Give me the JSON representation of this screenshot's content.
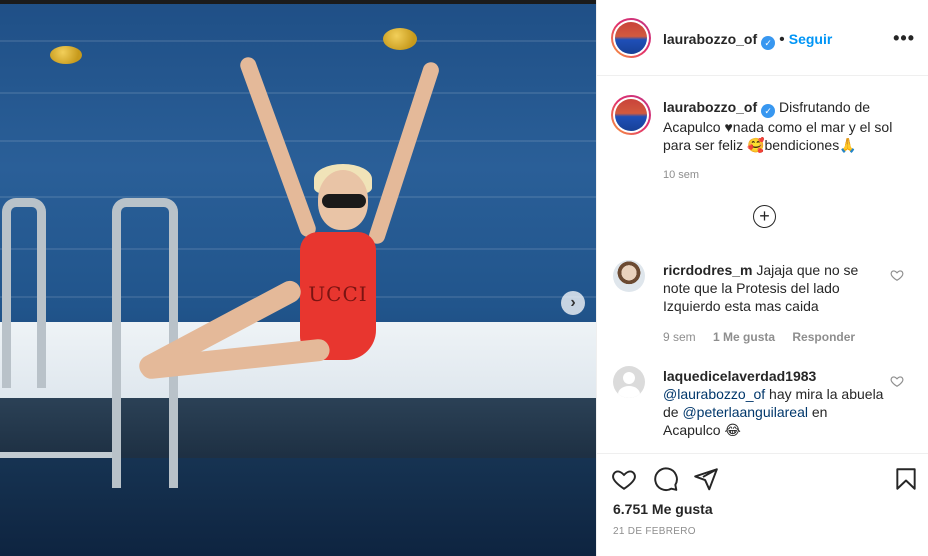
{
  "post": {
    "username": "laurabozzo_of",
    "follow_label": "Seguir",
    "separator": "•",
    "more_label": "•••",
    "caption_text": "Disfrutando de Acapulco ♥nada como el mar y el sol para ser feliz",
    "caption_tail": "bendiciones",
    "caption_emoji_1": "🥰",
    "caption_emoji_2": "🙏",
    "time_ago": "10 sem",
    "swimsuit_text": "UCCI"
  },
  "comments": [
    {
      "username": "ricrdodres_m",
      "text": "Jajaja que no se note que la Protesis del lado Izquierdo esta mas caida",
      "time": "9 sem",
      "likes": "1 Me gusta",
      "reply": "Responder"
    },
    {
      "username": "laquedicelaverdad1983",
      "mention1": "@laurabozzo_of",
      "text1": " hay mira la abuela de ",
      "mention2": "@peterlaanguilareal",
      "text2": " en Acapulco",
      "emoji": "😂"
    }
  ],
  "footer": {
    "likes_count": "6.751 Me gusta",
    "date": "21 DE FEBRERO"
  },
  "icons": {
    "verified": "✓",
    "next": "›",
    "plus": "+"
  },
  "colors": {
    "accent": "#0095f6",
    "mention": "#00376b",
    "muted": "#8e8e8e"
  }
}
